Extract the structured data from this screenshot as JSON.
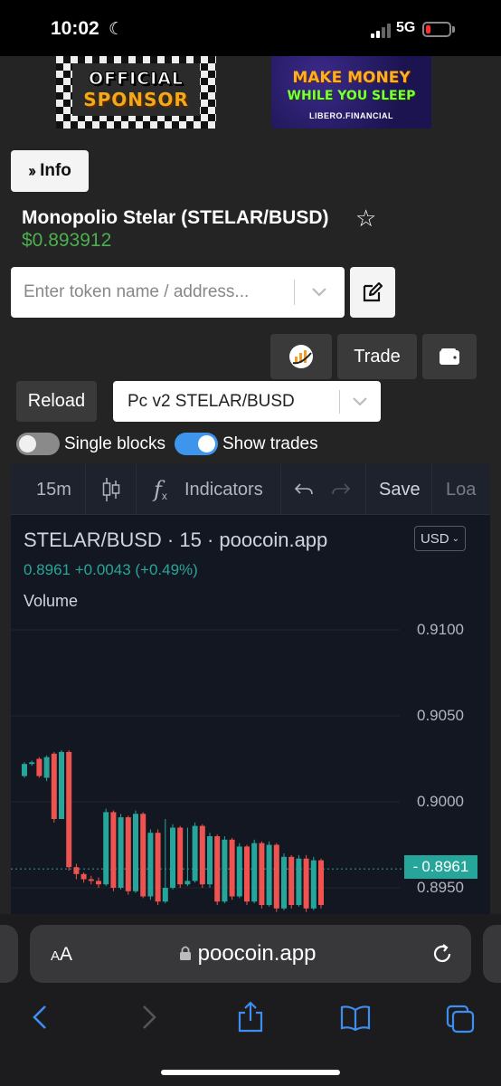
{
  "status_bar": {
    "time": "10:02",
    "network": "5G",
    "battery_level": 0.15
  },
  "banners": {
    "left": {
      "line1": "OFFICIAL",
      "line2": "SPONSOR"
    },
    "right": {
      "line1": "MAKE MONEY",
      "line2": "WHILE YOU SLEEP",
      "line3": "LIBERO.FINANCIAL"
    }
  },
  "info_button": {
    "label": "Info"
  },
  "token": {
    "title": "Monopolio Stelar (STELAR/BUSD)",
    "price": "$0.893912"
  },
  "search": {
    "placeholder": "Enter token name / address..."
  },
  "actions": {
    "trade_label": "Trade",
    "reload_label": "Reload"
  },
  "pair_select": {
    "value": "Pc v2 STELAR/BUSD"
  },
  "toggles": {
    "single_blocks": {
      "label": "Single blocks",
      "on": false
    },
    "show_trades": {
      "label": "Show trades",
      "on": true
    }
  },
  "chart_toolbar": {
    "interval": "15m",
    "indicators": "Indicators",
    "save": "Save",
    "load": "Loa"
  },
  "chart_legend": {
    "title": "STELAR/BUSD · 15 · poocoin.app",
    "values": "0.8961  +0.0043  (+0.49%)",
    "volume": "Volume",
    "currency": "USD"
  },
  "colors": {
    "up": "#26a69a",
    "down": "#ef5350",
    "price_green": "#4caf50",
    "accent": "#3d95ec"
  },
  "chart_data": {
    "type": "candlestick",
    "y_ticks": [
      "0.9100",
      "0.9050",
      "0.9000",
      "0.8950"
    ],
    "current_price": "0.8961",
    "ylim": [
      0.8935,
      0.9135
    ],
    "candles": [
      {
        "o": 0.9015,
        "c": 0.9022,
        "h": 0.9023,
        "l": 0.9014
      },
      {
        "o": 0.9022,
        "c": 0.9023,
        "h": 0.9024,
        "l": 0.9021
      },
      {
        "o": 0.9025,
        "c": 0.9015,
        "h": 0.9026,
        "l": 0.9014
      },
      {
        "o": 0.9014,
        "c": 0.9026,
        "h": 0.9027,
        "l": 0.9012
      },
      {
        "o": 0.9028,
        "c": 0.899,
        "h": 0.9029,
        "l": 0.8988
      },
      {
        "o": 0.899,
        "c": 0.9029,
        "h": 0.903,
        "l": 0.899
      },
      {
        "o": 0.9029,
        "c": 0.8962,
        "h": 0.903,
        "l": 0.896
      },
      {
        "o": 0.8962,
        "c": 0.8958,
        "h": 0.8964,
        "l": 0.8955
      },
      {
        "o": 0.8958,
        "c": 0.8955,
        "h": 0.8959,
        "l": 0.8953
      },
      {
        "o": 0.8955,
        "c": 0.8954,
        "h": 0.8957,
        "l": 0.8952
      },
      {
        "o": 0.8954,
        "c": 0.8952,
        "h": 0.8956,
        "l": 0.895
      },
      {
        "o": 0.8952,
        "c": 0.8994,
        "h": 0.8996,
        "l": 0.8951
      },
      {
        "o": 0.8994,
        "c": 0.895,
        "h": 0.8995,
        "l": 0.8948
      },
      {
        "o": 0.895,
        "c": 0.8991,
        "h": 0.8993,
        "l": 0.8949
      },
      {
        "o": 0.8991,
        "c": 0.8948,
        "h": 0.8992,
        "l": 0.8946
      },
      {
        "o": 0.8948,
        "c": 0.8993,
        "h": 0.8995,
        "l": 0.8947
      },
      {
        "o": 0.8993,
        "c": 0.8945,
        "h": 0.8994,
        "l": 0.8944
      },
      {
        "o": 0.8945,
        "c": 0.8982,
        "h": 0.8984,
        "l": 0.8943
      },
      {
        "o": 0.8982,
        "c": 0.8942,
        "h": 0.8984,
        "l": 0.894
      },
      {
        "o": 0.8942,
        "c": 0.895,
        "h": 0.899,
        "l": 0.8941
      },
      {
        "o": 0.895,
        "c": 0.8985,
        "h": 0.8987,
        "l": 0.8949
      },
      {
        "o": 0.8985,
        "c": 0.8952,
        "h": 0.8986,
        "l": 0.895
      },
      {
        "o": 0.8952,
        "c": 0.8954,
        "h": 0.8985,
        "l": 0.8951
      },
      {
        "o": 0.8954,
        "c": 0.8986,
        "h": 0.8988,
        "l": 0.8953
      },
      {
        "o": 0.8986,
        "c": 0.8952,
        "h": 0.8987,
        "l": 0.895
      },
      {
        "o": 0.8952,
        "c": 0.898,
        "h": 0.8982,
        "l": 0.895
      },
      {
        "o": 0.898,
        "c": 0.8942,
        "h": 0.8981,
        "l": 0.894
      },
      {
        "o": 0.8942,
        "c": 0.8978,
        "h": 0.898,
        "l": 0.8941
      },
      {
        "o": 0.8978,
        "c": 0.8945,
        "h": 0.8979,
        "l": 0.8943
      },
      {
        "o": 0.8945,
        "c": 0.8974,
        "h": 0.8976,
        "l": 0.8944
      },
      {
        "o": 0.8974,
        "c": 0.8942,
        "h": 0.8975,
        "l": 0.894
      },
      {
        "o": 0.8942,
        "c": 0.8976,
        "h": 0.8978,
        "l": 0.8941
      },
      {
        "o": 0.8976,
        "c": 0.894,
        "h": 0.8977,
        "l": 0.8938
      },
      {
        "o": 0.894,
        "c": 0.8975,
        "h": 0.8977,
        "l": 0.8939
      },
      {
        "o": 0.8975,
        "c": 0.8938,
        "h": 0.8976,
        "l": 0.8936
      },
      {
        "o": 0.8938,
        "c": 0.8968,
        "h": 0.897,
        "l": 0.8937
      },
      {
        "o": 0.8968,
        "c": 0.894,
        "h": 0.8969,
        "l": 0.8938
      },
      {
        "o": 0.894,
        "c": 0.8967,
        "h": 0.8969,
        "l": 0.8939
      },
      {
        "o": 0.8967,
        "c": 0.8938,
        "h": 0.8969,
        "l": 0.8936
      },
      {
        "o": 0.8938,
        "c": 0.8966,
        "h": 0.8968,
        "l": 0.8937
      },
      {
        "o": 0.8966,
        "c": 0.894,
        "h": 0.8967,
        "l": 0.8938
      }
    ]
  }
}
